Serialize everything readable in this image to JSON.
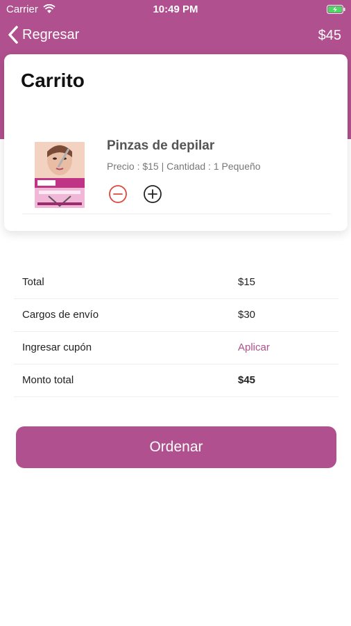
{
  "status_bar": {
    "carrier": "Carrier",
    "time": "10:49 PM",
    "wifi_icon": "wifi-icon",
    "battery_icon": "battery-charging-icon"
  },
  "nav": {
    "back_label": "Regresar",
    "back_icon": "chevron-left-icon",
    "price": "$45"
  },
  "cart": {
    "title": "Carrito",
    "items": [
      {
        "name": "Pinzas de depilar",
        "meta": "Precio : $15 | Cantidad : 1 Pequeño",
        "image_icon": "product-image",
        "decrease_icon": "minus-circle-icon",
        "increase_icon": "plus-circle-icon"
      }
    ]
  },
  "summary": {
    "rows": [
      {
        "label": "Total",
        "value": "$15"
      },
      {
        "label": "Cargos de envío",
        "value": "$30"
      },
      {
        "label": "Ingresar cupón",
        "value": "Aplicar"
      },
      {
        "label": "Monto total",
        "value": "$45"
      }
    ]
  },
  "order_button_label": "Ordenar",
  "colors": {
    "brand": "#b0508e",
    "minus": "#e0453c",
    "background": "#ffffff"
  }
}
